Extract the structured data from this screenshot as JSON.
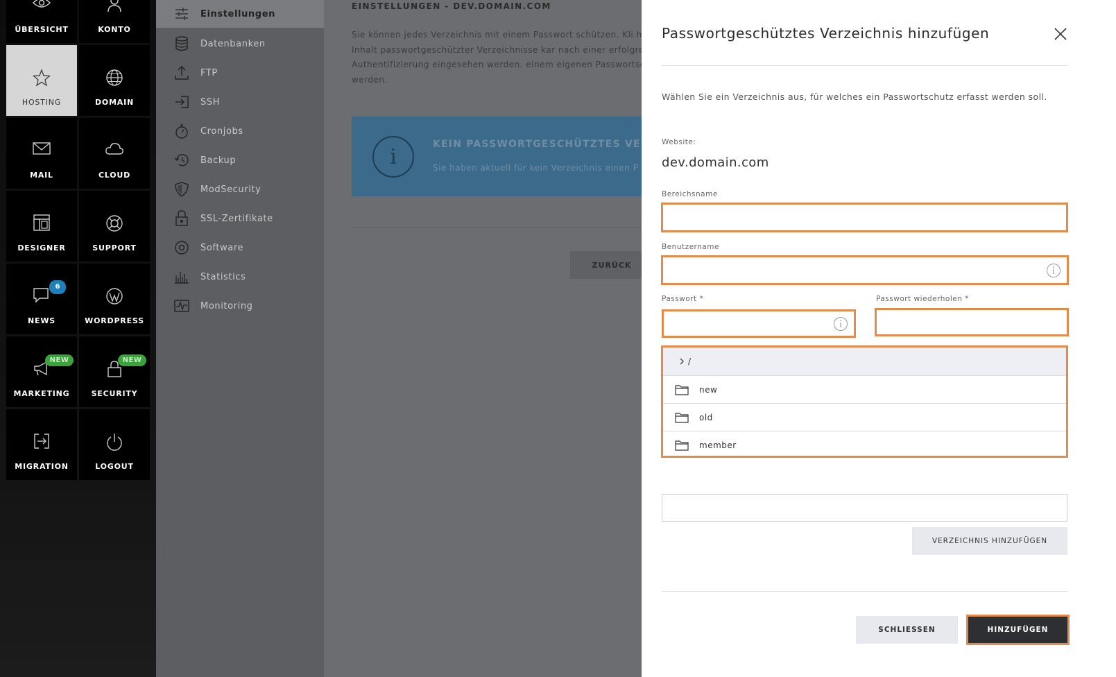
{
  "tilenav": {
    "tiles": [
      {
        "label": "ÜBERSICHT",
        "icon": "eye-icon"
      },
      {
        "label": "KONTO",
        "icon": "user-icon"
      },
      {
        "label": "HOSTING",
        "icon": "star-icon",
        "active": true
      },
      {
        "label": "DOMAIN",
        "icon": "globe-icon"
      },
      {
        "label": "MAIL",
        "icon": "envelope-icon"
      },
      {
        "label": "CLOUD",
        "icon": "cloud-icon"
      },
      {
        "label": "DESIGNER",
        "icon": "layout-icon"
      },
      {
        "label": "SUPPORT",
        "icon": "lifebuoy-icon"
      },
      {
        "label": "NEWS",
        "icon": "speech-bubble-icon",
        "badge": "6"
      },
      {
        "label": "WORDPRESS",
        "icon": "wordpress-icon"
      },
      {
        "label": "MARKETING",
        "icon": "megaphone-icon",
        "badge": "NEW"
      },
      {
        "label": "SECURITY",
        "icon": "lock-icon",
        "badge": "NEW"
      },
      {
        "label": "MIGRATION",
        "icon": "migration-icon"
      },
      {
        "label": "LOGOUT",
        "icon": "power-icon"
      }
    ]
  },
  "subnav": {
    "items": [
      {
        "label": "Einstellungen",
        "icon": "sliders-icon",
        "active": true
      },
      {
        "label": "Datenbanken",
        "icon": "database-icon"
      },
      {
        "label": "FTP",
        "icon": "upload-icon"
      },
      {
        "label": "SSH",
        "icon": "login-icon"
      },
      {
        "label": "Cronjobs",
        "icon": "stopwatch-icon"
      },
      {
        "label": "Backup",
        "icon": "history-icon"
      },
      {
        "label": "ModSecurity",
        "icon": "shield-icon"
      },
      {
        "label": "SSL-Zertifikate",
        "icon": "padlock-icon"
      },
      {
        "label": "Software",
        "icon": "disc-icon"
      },
      {
        "label": "Statistics",
        "icon": "bar-chart-icon"
      },
      {
        "label": "Monitoring",
        "icon": "pulse-icon"
      }
    ]
  },
  "main": {
    "title": "EINSTELLUNGEN - DEV.DOMAIN.COM",
    "description": "Sie können jedes Verzeichnis mit einem Passwort schützen. Kli hinzufügen». Der Inhalt passwortgeschützter Verzeichnisse kar nach einer erfolgreichen Authentifizierung eingesehen werden. einem eigenen Passwortschutz ausgestattet werden.",
    "info_title": "KEIN PASSWORTGESCHÜTZTES VERZ",
    "info_text": "Sie haben aktuell für kein Verzeichnis einen P",
    "info_icon_glyph": "i",
    "back_label": "ZURÜCK"
  },
  "modal": {
    "title": "Passwortgeschütztes Verzeichnis hinzufügen",
    "intro": "Wählen Sie ein Verzeichnis aus, für welches ein Passwortschutz erfasst werden soll.",
    "website_label": "Website:",
    "website_value": "dev.domain.com",
    "bereichsname_label": "Bereichsname",
    "benutzername_label": "Benutzername",
    "passwort_label": "Passwort *",
    "passwort_repeat_label": "Passwort wiederholen *",
    "tree": {
      "root": "/",
      "folders": [
        "new",
        "old",
        "member"
      ]
    },
    "add_directory_label": "VERZEICHNIS HINZUFÜGEN",
    "close_label": "SCHLIESSEN",
    "submit_label": "HINZUFÜGEN",
    "highlight_color": "#e48a4a"
  }
}
